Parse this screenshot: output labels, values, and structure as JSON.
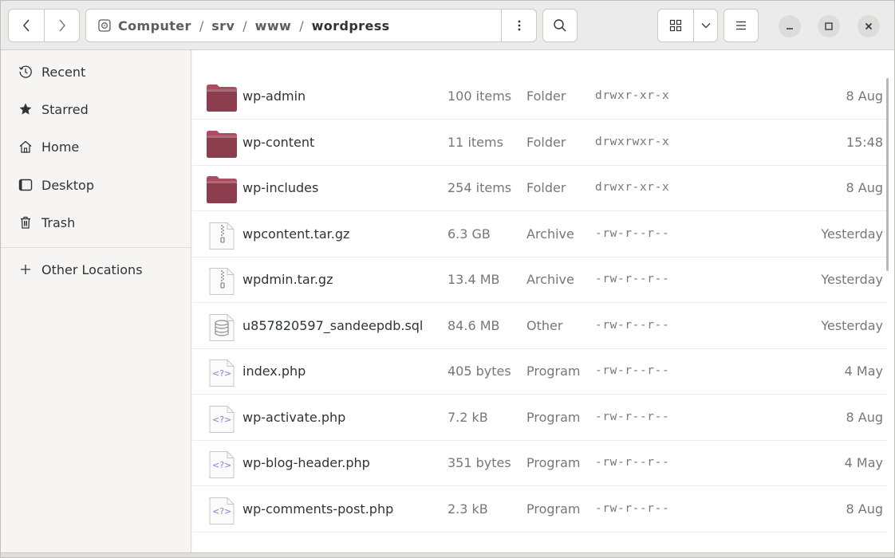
{
  "window": {
    "title": "wordpress"
  },
  "toolbar": {
    "back_icon": "chevron-left-icon",
    "forward_icon": "chevron-right-icon",
    "path": [
      "Computer",
      "srv",
      "www",
      "wordpress"
    ],
    "path_separator": "/",
    "path_menu_icon": "vertical-ellipsis-icon",
    "search_icon": "search-icon",
    "view_icon": "grid-view-icon",
    "view_dropdown_icon": "chevron-down-icon",
    "main_menu_icon": "hamburger-menu-icon",
    "minimize_icon": "minimize-icon",
    "maximize_icon": "maximize-icon",
    "close_icon": "close-icon"
  },
  "sidebar": {
    "items": [
      {
        "label": "Recent",
        "icon": "clock-icon"
      },
      {
        "label": "Starred",
        "icon": "star-icon"
      },
      {
        "label": "Home",
        "icon": "home-icon"
      },
      {
        "label": "Desktop",
        "icon": "desktop-icon"
      },
      {
        "label": "Trash",
        "icon": "trash-icon"
      }
    ],
    "other_locations": {
      "label": "Other Locations",
      "icon": "plus-icon"
    }
  },
  "files": [
    {
      "name": "wp-admin",
      "size": "100 items",
      "type": "Folder",
      "permissions": "drwxr-xr-x",
      "modified": "8 Aug",
      "icon": "folder-icon"
    },
    {
      "name": "wp-content",
      "size": "11 items",
      "type": "Folder",
      "permissions": "drwxrwxr-x",
      "modified": "15:48",
      "icon": "folder-icon"
    },
    {
      "name": "wp-includes",
      "size": "254 items",
      "type": "Folder",
      "permissions": "drwxr-xr-x",
      "modified": "8 Aug",
      "icon": "folder-icon"
    },
    {
      "name": "wpcontent.tar.gz",
      "size": "6.3 GB",
      "type": "Archive",
      "permissions": "-rw-r--r--",
      "modified": "Yesterday",
      "icon": "archive-icon"
    },
    {
      "name": "wpdmin.tar.gz",
      "size": "13.4 MB",
      "type": "Archive",
      "permissions": "-rw-r--r--",
      "modified": "Yesterday",
      "icon": "archive-icon"
    },
    {
      "name": "u857820597_sandeepdb.sql",
      "size": "84.6 MB",
      "type": "Other",
      "permissions": "-rw-r--r--",
      "modified": "Yesterday",
      "icon": "database-icon"
    },
    {
      "name": "index.php",
      "size": "405 bytes",
      "type": "Program",
      "permissions": "-rw-r--r--",
      "modified": "4 May",
      "icon": "php-file-icon"
    },
    {
      "name": "wp-activate.php",
      "size": "7.2 kB",
      "type": "Program",
      "permissions": "-rw-r--r--",
      "modified": "8 Aug",
      "icon": "php-file-icon"
    },
    {
      "name": "wp-blog-header.php",
      "size": "351 bytes",
      "type": "Program",
      "permissions": "-rw-r--r--",
      "modified": "4 May",
      "icon": "php-file-icon"
    },
    {
      "name": "wp-comments-post.php",
      "size": "2.3 kB",
      "type": "Program",
      "permissions": "-rw-r--r--",
      "modified": "8 Aug",
      "icon": "php-file-icon"
    }
  ],
  "colors": {
    "folder": "#8c3d4e",
    "folder_tab": "#b04a5e",
    "php_accent": "#8a7bd8"
  }
}
